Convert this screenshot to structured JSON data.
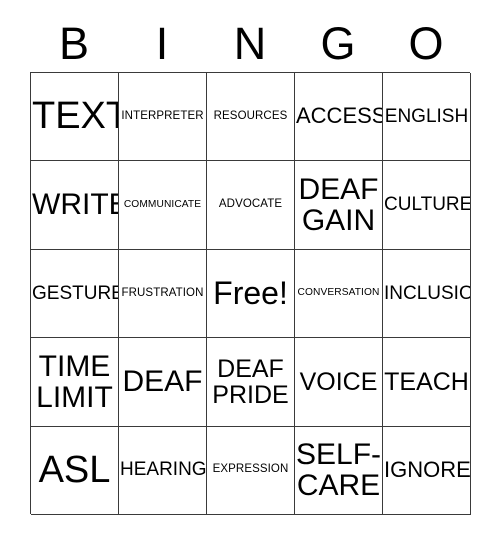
{
  "card": {
    "header_letters": [
      "B",
      "I",
      "N",
      "G",
      "O"
    ],
    "columns": 5,
    "rows": 5,
    "free_space": "Free!",
    "colors": {
      "background": "#ffffff",
      "text": "#000000",
      "grid_line": "#3a3a3a"
    },
    "cells": [
      {
        "text": "TEXT",
        "size": "sz-xl"
      },
      {
        "text": "INTERPRETER",
        "size": "sz-tiny"
      },
      {
        "text": "RESOURCES",
        "size": "sz-tiny"
      },
      {
        "text": "ACCESS",
        "size": "sz-sm"
      },
      {
        "text": "ENGLISH",
        "size": "sz-xs"
      },
      {
        "text": "WRITE",
        "size": "sz-md2"
      },
      {
        "text": "COMMUNICATE",
        "size": "sz-min"
      },
      {
        "text": "ADVOCATE",
        "size": "sz-tiny"
      },
      {
        "text": "DEAF\nGAIN",
        "size": "sz-md2"
      },
      {
        "text": "CULTURE",
        "size": "sz-xs"
      },
      {
        "text": "GESTURE",
        "size": "sz-xs"
      },
      {
        "text": "FRUSTRATION",
        "size": "sz-tiny"
      },
      {
        "text": "Free!",
        "size": "sz-lg"
      },
      {
        "text": "CONVERSATION",
        "size": "sz-min"
      },
      {
        "text": "INCLUSION",
        "size": "sz-xs"
      },
      {
        "text": "TIME\nLIMIT",
        "size": "sz-md2"
      },
      {
        "text": "DEAF",
        "size": "sz-md2"
      },
      {
        "text": "DEAF\nPRIDE",
        "size": "sz-md"
      },
      {
        "text": "VOICE",
        "size": "sz-md"
      },
      {
        "text": "TEACH",
        "size": "sz-md"
      },
      {
        "text": "ASL",
        "size": "sz-xl"
      },
      {
        "text": "HEARING",
        "size": "sz-xs"
      },
      {
        "text": "EXPRESSION",
        "size": "sz-tiny"
      },
      {
        "text": "SELF-\nCARE",
        "size": "sz-md2"
      },
      {
        "text": "IGNORE",
        "size": "sz-sm"
      }
    ]
  }
}
